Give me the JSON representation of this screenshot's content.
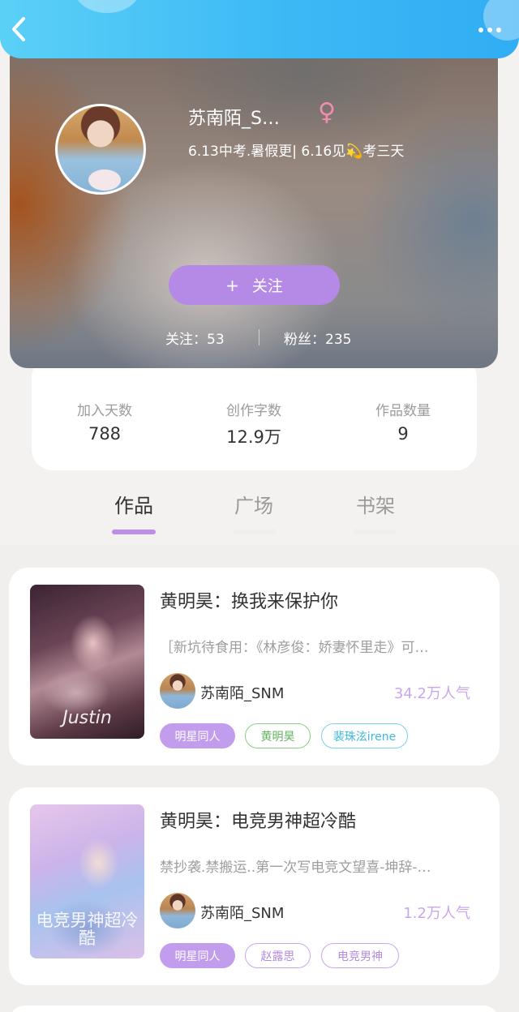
{
  "header": {
    "username": "苏南陌_S…",
    "bio": "6.13中考.暑假更| 6.16见💫考三天",
    "gender_icon": "female-icon",
    "follow_button": {
      "plus": "+",
      "label": "关注"
    },
    "following": "关注：53",
    "fans": "粉丝：235"
  },
  "stats": [
    {
      "label": "加入天数",
      "value": "788"
    },
    {
      "label": "创作字数",
      "value": "12.9万"
    },
    {
      "label": "作品数量",
      "value": "9"
    }
  ],
  "tabs": [
    {
      "label": "作品",
      "active": true
    },
    {
      "label": "广场",
      "active": false
    },
    {
      "label": "书架",
      "active": false
    }
  ],
  "works": [
    {
      "title": "黄明昊：换我来保护你",
      "description": "［新坑待食用：《林彦俊：娇妻怀里走》可…",
      "author": "苏南陌_SNM",
      "popularity": "34.2万人气",
      "cover_text": "Justin",
      "tags": [
        "明星同人",
        "黄明昊",
        "裴珠泫irene"
      ]
    },
    {
      "title": "黄明昊：电竞男神超冷酷",
      "description": "禁抄袭.禁搬运..第一次写电竞文望喜-坤辞-…",
      "author": "苏南陌_SNM",
      "popularity": "1.2万人气",
      "cover_text": "电竞男神超冷酷",
      "tags": [
        "明星同人",
        "赵露思",
        "电竞男神"
      ]
    }
  ],
  "colors": {
    "topbar": "#3cb9f5",
    "accent": "#b58ae6",
    "popularity": "#c9a6ef"
  }
}
